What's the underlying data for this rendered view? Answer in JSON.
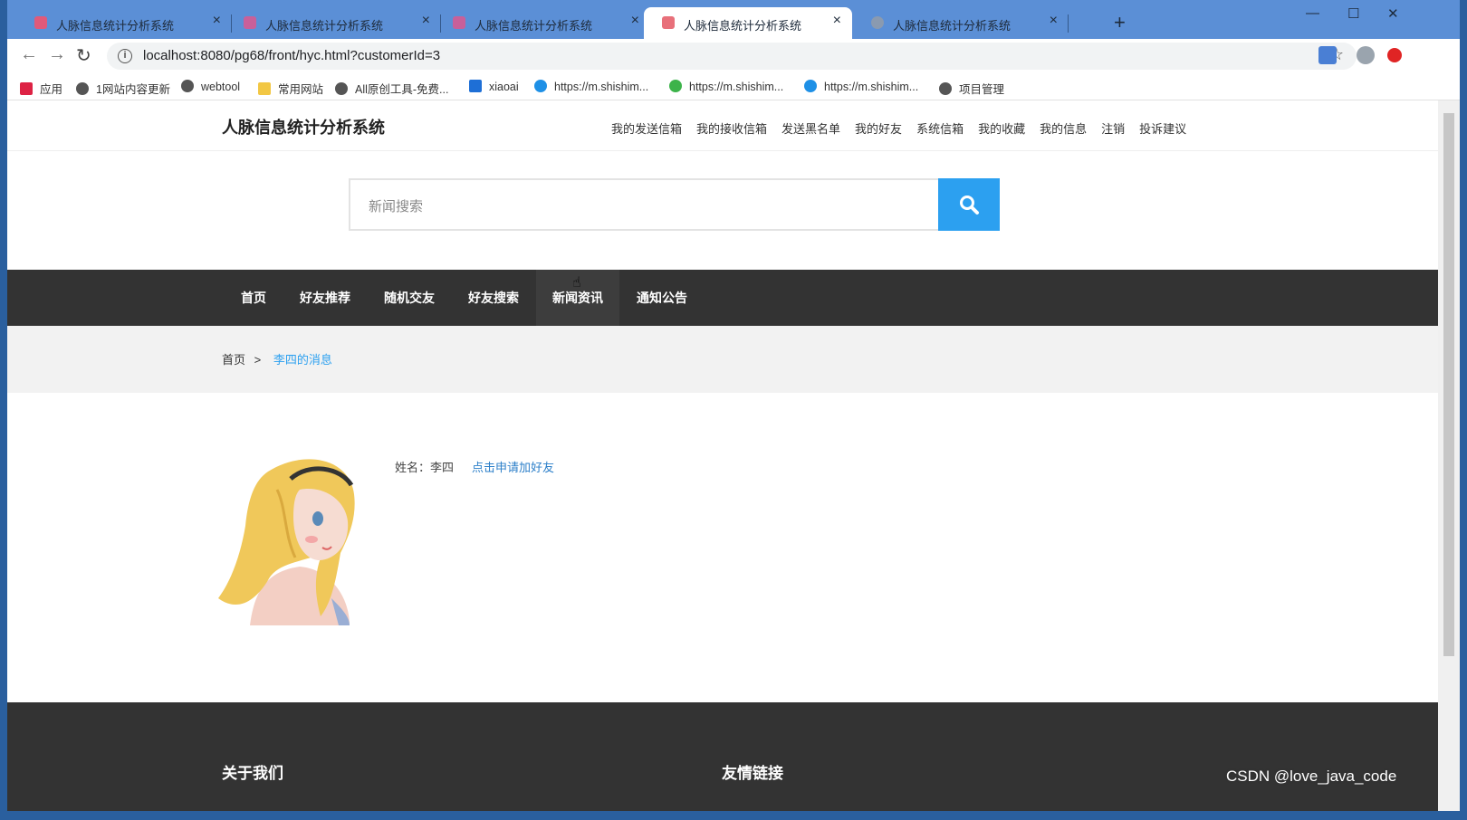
{
  "browser": {
    "tabs": [
      {
        "title": "人脉信息统计分析系统",
        "active": false
      },
      {
        "title": "人脉信息统计分析系统",
        "active": false
      },
      {
        "title": "人脉信息统计分析系统",
        "active": false
      },
      {
        "title": "人脉信息统计分析系统",
        "active": true
      },
      {
        "title": "人脉信息统计分析系统",
        "active": false
      }
    ],
    "url": "localhost:8080/pg68/front/hyc.html?customerId=3",
    "bookmarks": [
      "应用",
      "1网站内容更新",
      "webtool",
      "常用网站",
      "All原创工具-免费...",
      "xiaoai",
      "https://m.shishim...",
      "https://m.shishim...",
      "https://m.shishim...",
      "项目管理"
    ]
  },
  "site": {
    "title": "人脉信息统计分析系统",
    "topnav": [
      "我的发送信箱",
      "我的接收信箱",
      "发送黑名单",
      "我的好友",
      "系统信箱",
      "我的收藏",
      "我的信息",
      "注销",
      "投诉建议"
    ],
    "search_placeholder": "新闻搜索",
    "mainnav": [
      "首页",
      "好友推荐",
      "随机交友",
      "好友搜索",
      "新闻资讯",
      "通知公告"
    ],
    "breadcrumb": {
      "home": "首页",
      "sep": ">",
      "current": "李四的消息"
    },
    "profile": {
      "name_label": "姓名：李四",
      "apply_link": "点击申请加好友"
    },
    "footer": {
      "about": "关于我们",
      "links": "友情链接"
    }
  },
  "watermark": "CSDN @love_java_code",
  "colors": {
    "accent": "#2ca0f0",
    "nav_bg": "#333333",
    "tabstrip": "#5b8fd6"
  }
}
